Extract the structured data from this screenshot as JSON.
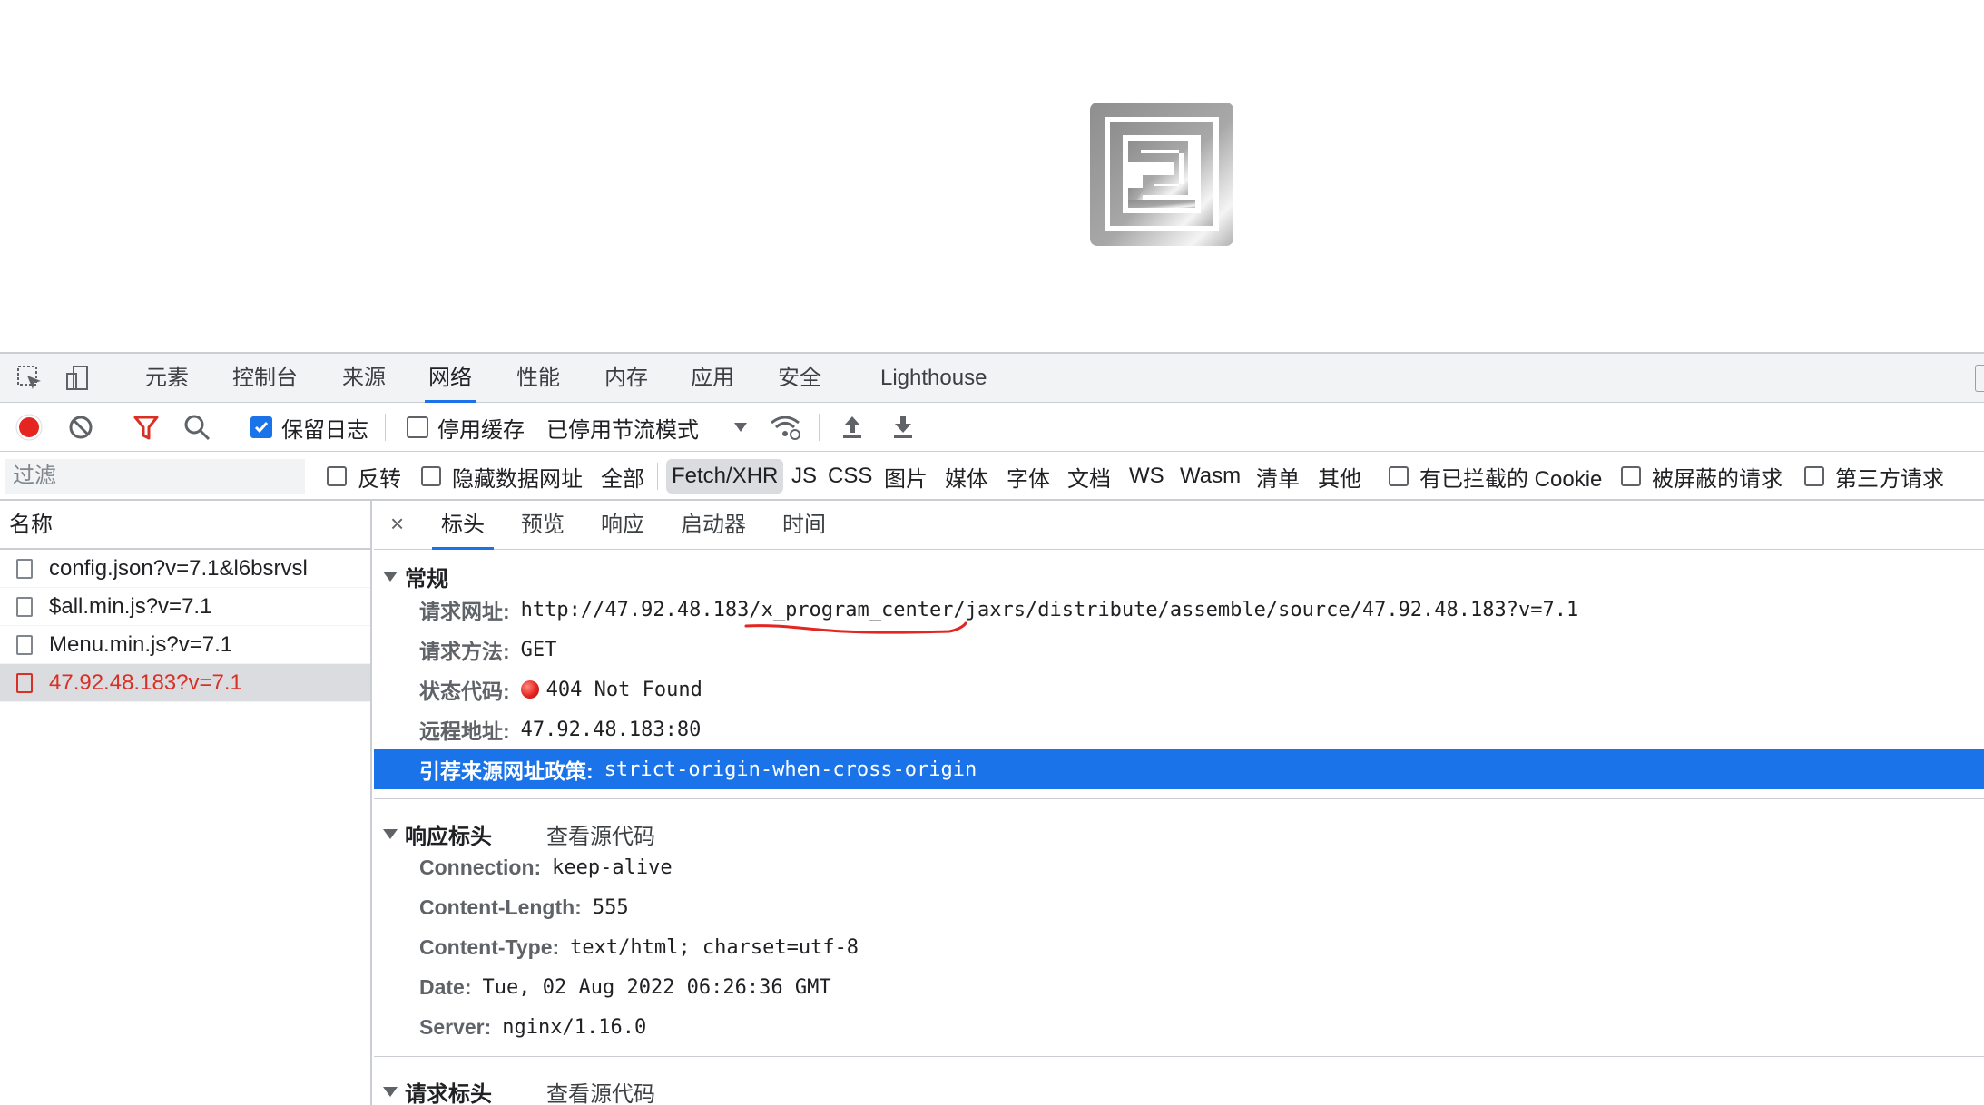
{
  "tabbar": {
    "tabs": [
      "元素",
      "控制台",
      "来源",
      "网络",
      "性能",
      "内存",
      "应用",
      "安全",
      "Lighthouse"
    ],
    "active": "网络"
  },
  "toolbar": {
    "preserve_log": "保留日志",
    "disable_cache": "停用缓存",
    "throttling": "已停用节流模式"
  },
  "filterbar": {
    "placeholder": "过滤",
    "invert": "反转",
    "hide_data_urls": "隐藏数据网址",
    "types": [
      "全部",
      "Fetch/XHR",
      "JS",
      "CSS",
      "图片",
      "媒体",
      "字体",
      "文档",
      "WS",
      "Wasm",
      "清单",
      "其他"
    ],
    "active_type": "Fetch/XHR",
    "blocked_cookies": "有已拦截的 Cookie",
    "blocked_requests": "被屏蔽的请求",
    "third_party": "第三方请求"
  },
  "requests": {
    "header": "名称",
    "items": [
      "config.json?v=7.1&l6bsrvsl",
      "$all.min.js?v=7.1",
      "Menu.min.js?v=7.1",
      "47.92.48.183?v=7.1"
    ],
    "selected_index": 3
  },
  "detail": {
    "close": "×",
    "tabs": [
      "标头",
      "预览",
      "响应",
      "启动器",
      "时间"
    ],
    "active_tab": "标头",
    "general": {
      "title": "常规",
      "rows": [
        {
          "k": "请求网址:",
          "v": "http://47.92.48.183/x_program_center/jaxrs/distribute/assemble/source/47.92.48.183?v=7.1"
        },
        {
          "k": "请求方法:",
          "v": "GET"
        },
        {
          "k": "状态代码:",
          "v": "404 Not Found"
        },
        {
          "k": "远程地址:",
          "v": "47.92.48.183:80"
        },
        {
          "k": "引荐来源网址政策:",
          "v": "strict-origin-when-cross-origin"
        }
      ]
    },
    "response_headers": {
      "title": "响应标头",
      "view_source": "查看源代码",
      "rows": [
        {
          "k": "Connection:",
          "v": "keep-alive"
        },
        {
          "k": "Content-Length:",
          "v": "555"
        },
        {
          "k": "Content-Type:",
          "v": "text/html; charset=utf-8"
        },
        {
          "k": "Date:",
          "v": "Tue, 02 Aug 2022 06:26:36 GMT"
        },
        {
          "k": "Server:",
          "v": "nginx/1.16.0"
        }
      ]
    },
    "request_headers": {
      "title": "请求标头",
      "view_source": "查看源代码"
    }
  },
  "colors": {
    "accent": "#1a73e8",
    "error": "#d93025",
    "annotation": "#e52521"
  }
}
